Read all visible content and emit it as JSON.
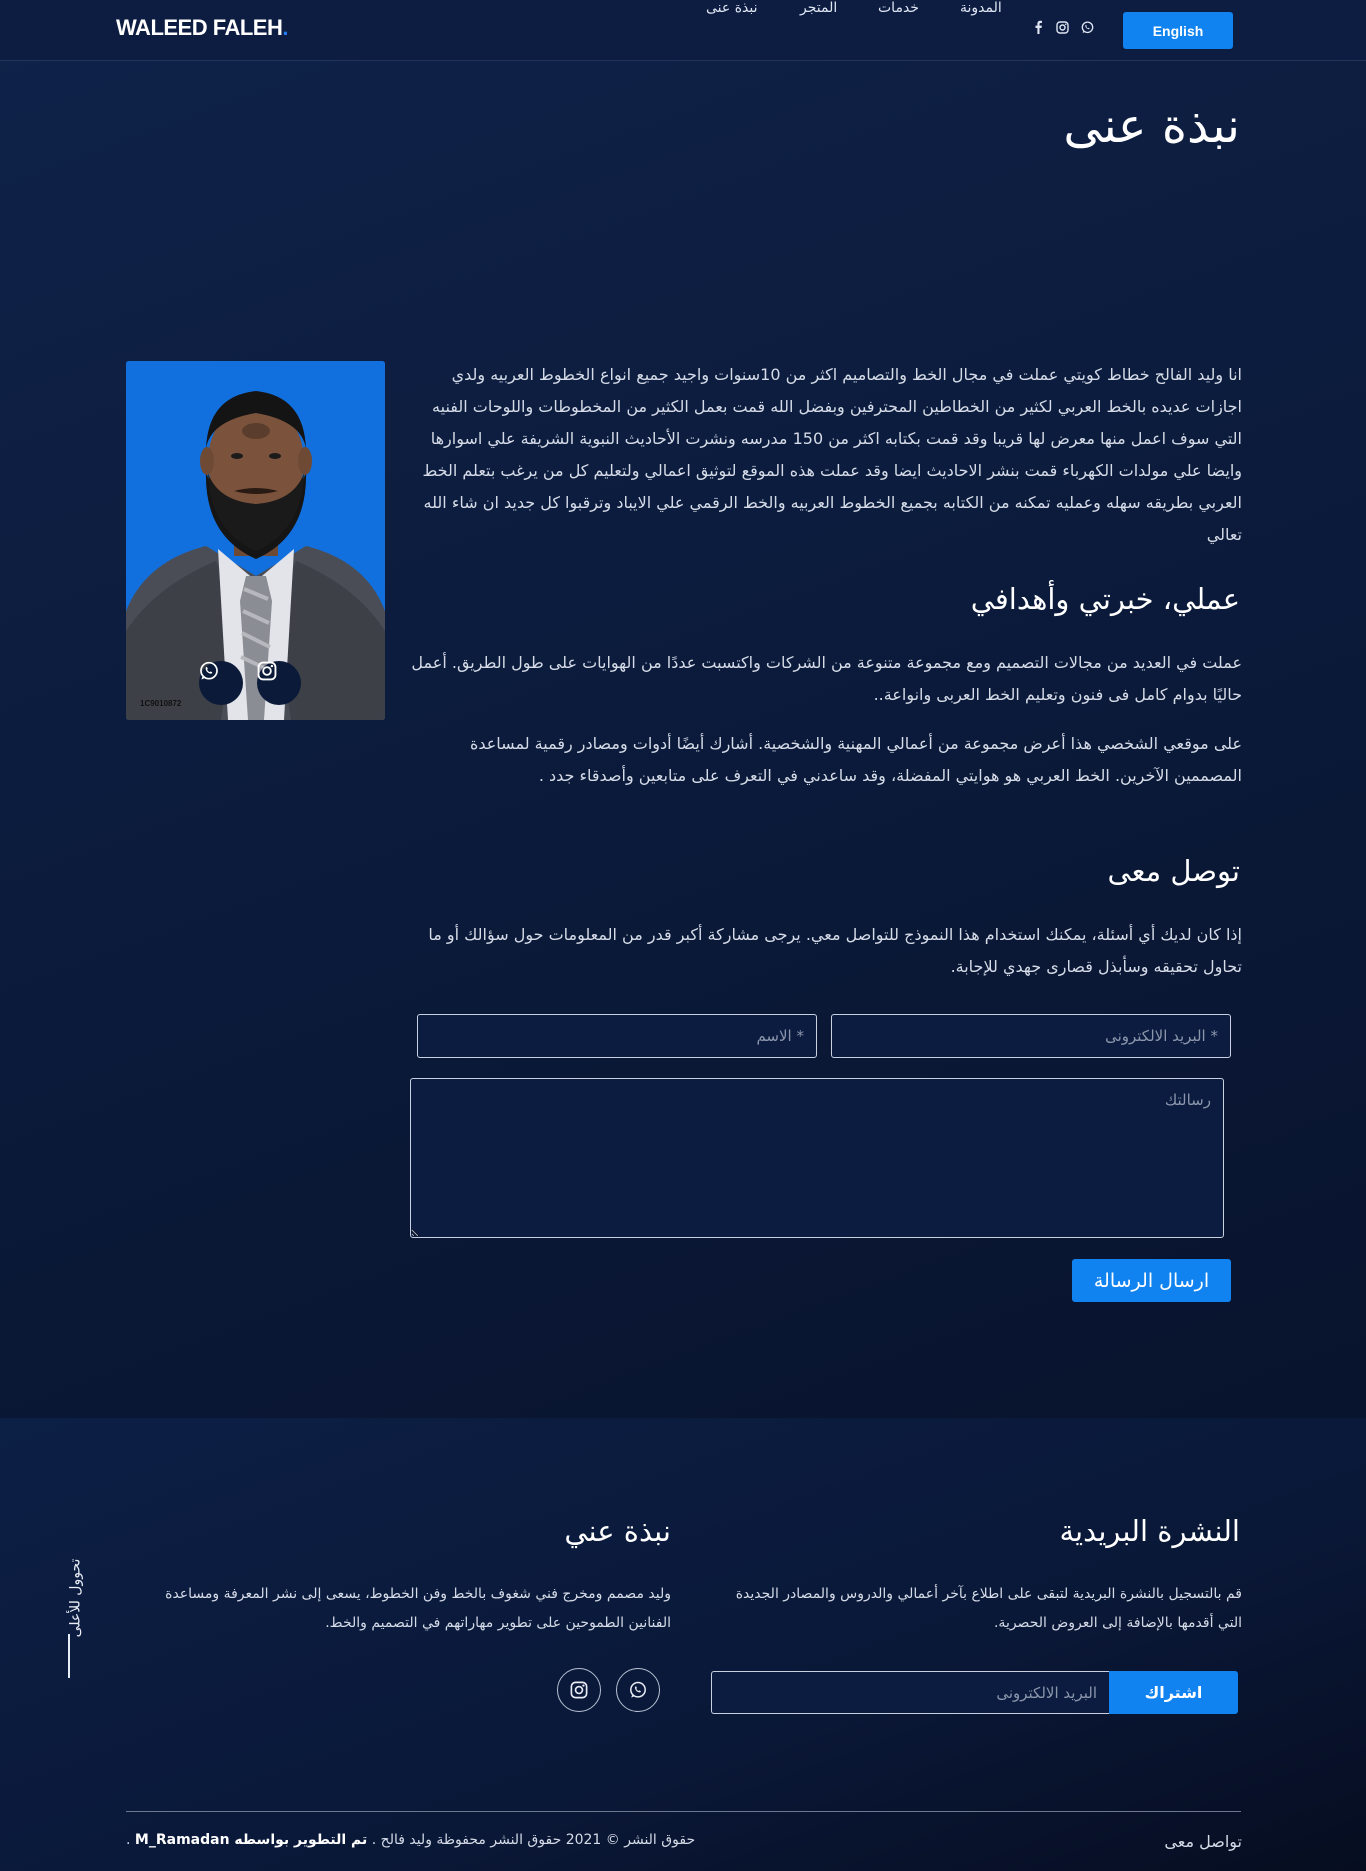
{
  "header": {
    "logo_text": "WALEED FALEH",
    "logo_dot": ".",
    "nav": [
      {
        "label": "نبذة عنى"
      },
      {
        "label": "المتجر"
      },
      {
        "label": "خدمات"
      },
      {
        "label": "المدونة"
      }
    ],
    "social_icons": [
      "facebook-icon",
      "instagram-icon",
      "whatsapp-icon"
    ],
    "language_button": "English"
  },
  "hero": {
    "title": "نبذة عنى"
  },
  "profile": {
    "photo_id_text": "1C9010872",
    "buttons": [
      "whatsapp-icon",
      "instagram-icon"
    ]
  },
  "about": {
    "intro": "انا وليد الفالح خطاط كويتي عملت في مجال الخط والتصاميم اكثر من 10سنوات واجيد جميع انواع الخطوط العربيه ولدي اجازات عديده بالخط العربي لكثير من الخطاطين المحترفين وبفضل الله قمت بعمل الكثير من المخطوطات واللوحات الفنيه التي سوف اعمل منها معرض لها قريبا وقد قمت بكتابه اكثر من 150 مدرسه ونشرت الأحاديث النبوية الشريفة علي اسوارها وايضا علي مولدات الكهرباء قمت بنشر الاحاديث ايضا وقد عملت هذه الموقع لتوثيق اعمالي ولتعليم كل من يرغب بتعلم الخط العربي بطريقه سهله وعمليه تمكنه من الكتابه بجميع الخطوط العربيه والخط الرقمي علي الايباد وترقبوا كل جديد ان شاء الله تعالي",
    "goals_title": "عملي، خبرتي وأهدافي",
    "goals_p1": "عملت في العديد من مجالات التصميم ومع مجموعة متنوعة من الشركات واكتسبت عددًا من الهوايات على طول الطريق. أعمل حاليًا بدوام كامل فى فنون وتعليم الخط العربى وانواعة..",
    "goals_p2": "على موقعي الشخصي هذا أعرض مجموعة من أعمالي المهنية والشخصية. أشارك أيضًا أدوات ومصادر رقمية لمساعدة المصممين الآخرين. الخط العربي هو هوايتي المفضلة، وقد ساعدني في التعرف على متابعين وأصدقاء جدد ."
  },
  "contact": {
    "title": "توصل معى",
    "text": "إذا كان لديك أي أسئلة، يمكنك استخدام هذا النموذج للتواصل معي. يرجى مشاركة أكبر قدر من المعلومات حول سؤالك أو ما تحاول تحقيقه وسأبذل قصارى جهدي للإجابة.",
    "email_placeholder": "* البريد الالكترونى",
    "name_placeholder": "* الاسم",
    "message_placeholder": "رسالتك",
    "send_label": "ارسال الرسالة"
  },
  "footer": {
    "vertical_label": "تحوول للأعلى",
    "newsletter_title": "النشرة البريدية",
    "newsletter_text": "قم بالتسجيل بالنشرة البريدية لتبقى على اطلاع بآخر أعمالي والدروس والمصادر الجديدة التي أقدمها بالإضافة إلى العروض الحصرية.",
    "subscribe_placeholder": "البريد الالكترونى",
    "subscribe_label": "اشتراك",
    "about_title": "نبذة عني",
    "about_text": "وليد مصمم ومخرج فني شغوف بالخط وفن الخطوط، يسعى إلى نشر المعرفة ومساعدة الفنانين الطموحين على تطوير مهاراتهم في التصميم والخط.",
    "social_icons": [
      "whatsapp-icon",
      "instagram-icon"
    ],
    "contact_link": "تواصل معى",
    "copyright_prefix": "حقوق النشر © 2021 حقوق النشر محفوظة وليد فالح .",
    "credit": "تم التطوير بواسطه M_Ramadan",
    "copyright_suffix": "."
  }
}
